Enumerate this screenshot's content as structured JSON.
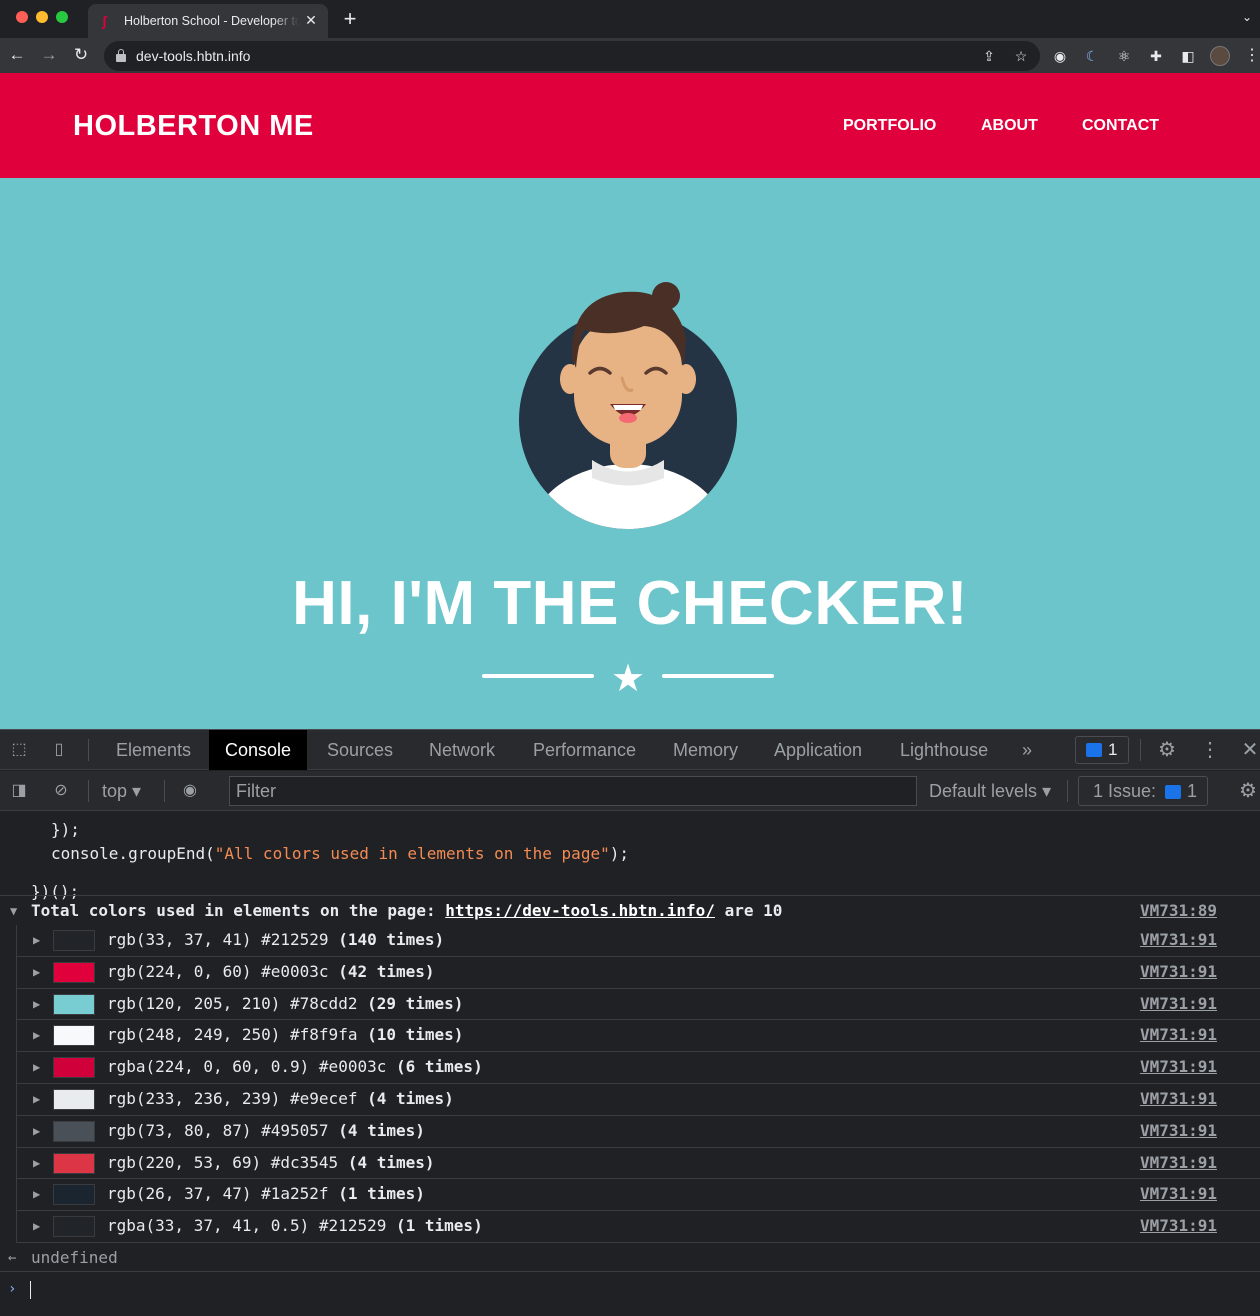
{
  "browser": {
    "tab_title": "Holberton School - Developer tools",
    "tab_favicon": "holberton-favicon",
    "url": "dev-tools.hbtn.info",
    "icons": [
      "back-icon",
      "forward-icon",
      "reload-icon",
      "lock-icon",
      "share-icon",
      "star-icon",
      "extension-icon",
      "puzzle-icon",
      "sidebar-icon",
      "profile-avatar",
      "menu-icon"
    ]
  },
  "site": {
    "brand": "HOLBERTON ME",
    "nav": [
      "PORTFOLIO",
      "ABOUT",
      "CONTACT"
    ],
    "hero_title": "HI, I'M THE CHECKER!",
    "colors": {
      "header": "#e0003c",
      "hero": "#6cc5ca"
    }
  },
  "devtools": {
    "tabs": [
      "Elements",
      "Console",
      "Sources",
      "Network",
      "Performance",
      "Memory",
      "Application",
      "Lighthouse"
    ],
    "active_tab": "Console",
    "messages_count": "1",
    "context": "top",
    "filter_placeholder": "Filter",
    "levels": "Default levels",
    "issues_label": "1 Issue:",
    "issues_count": "1"
  },
  "console": {
    "code_lines": [
      "});",
      "console.groupEnd(\"All colors used in elements on the page\");",
      "})();"
    ],
    "code_call": "console.groupEnd(",
    "code_string": "\"All colors used in elements on the page\"",
    "code_tail": ");",
    "group_prefix": "Total colors used in elements on the page: ",
    "group_link": "https://dev-tools.hbtn.info/",
    "group_suffix": " are 10",
    "group_source": "VM731:89",
    "rows": [
      {
        "value": "rgb(33, 37, 41) #212529",
        "count": "(140 times)",
        "swatch": "#212529",
        "source": "VM731:91"
      },
      {
        "value": "rgb(224, 0, 60) #e0003c",
        "count": "(42 times)",
        "swatch": "#e0003c",
        "source": "VM731:91"
      },
      {
        "value": "rgb(120, 205, 210) #78cdd2",
        "count": "(29 times)",
        "swatch": "#78cdd2",
        "source": "VM731:91"
      },
      {
        "value": "rgb(248, 249, 250) #f8f9fa",
        "count": "(10 times)",
        "swatch": "#f8f9fa",
        "source": "VM731:91"
      },
      {
        "value": "rgba(224, 0, 60, 0.9) #e0003c",
        "count": "(6 times)",
        "swatch": "#d0003a",
        "source": "VM731:91"
      },
      {
        "value": "rgb(233, 236, 239) #e9ecef",
        "count": "(4 times)",
        "swatch": "#e9ecef",
        "source": "VM731:91"
      },
      {
        "value": "rgb(73, 80, 87) #495057",
        "count": "(4 times)",
        "swatch": "#495057",
        "source": "VM731:91"
      },
      {
        "value": "rgb(220, 53, 69) #dc3545",
        "count": "(4 times)",
        "swatch": "#dc3545",
        "source": "VM731:91"
      },
      {
        "value": "rgb(26, 37, 47) #1a252f",
        "count": "(1 times)",
        "swatch": "#1a252f",
        "source": "VM731:91"
      },
      {
        "value": "rgba(33, 37, 41, 0.5) #212529",
        "count": "(1 times)",
        "swatch": "#212529",
        "source": "VM731:91"
      }
    ],
    "result": "undefined"
  }
}
